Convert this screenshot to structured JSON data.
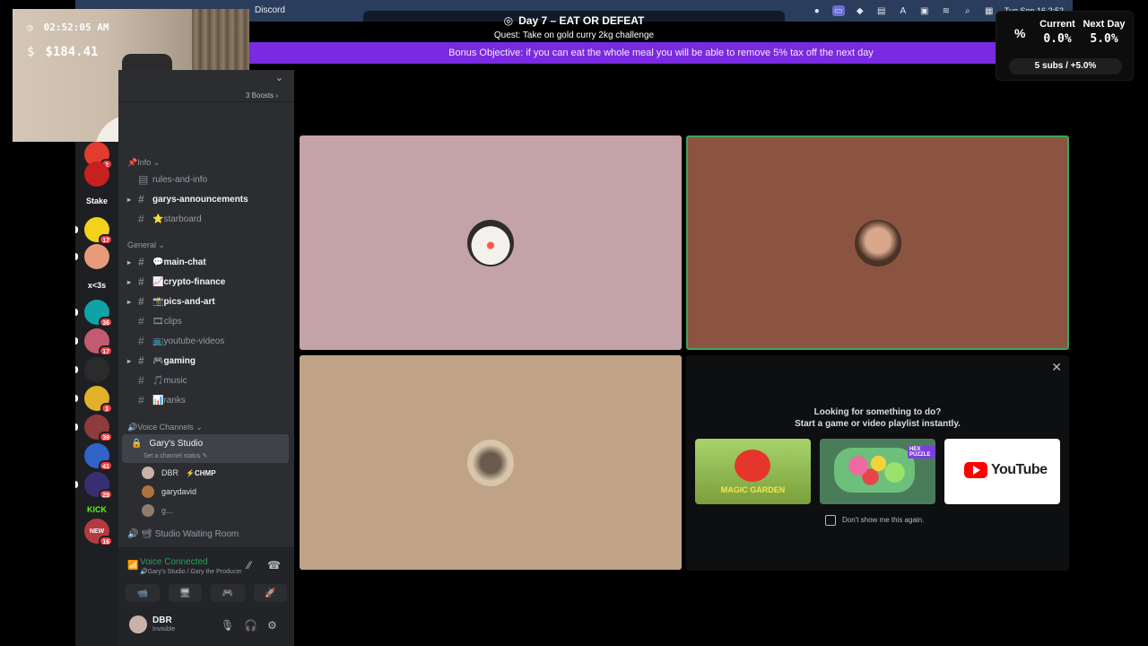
{
  "menubar": {
    "app_title": "Discord",
    "datetime": "Tue Sep 16  2:52"
  },
  "stream": {
    "title": "Day 7 – EAT OR DEFEAT",
    "title_icon": "◎",
    "quest": "Quest: Take on gold curry 2kg challenge",
    "bonus": "Bonus Objective: if you can eat the whole meal you will be able to remove 5% tax off the next day",
    "bonus_close": "✕"
  },
  "webcam": {
    "clock_icon": "◷",
    "time": "02:52:05 AM",
    "money_icon": "$",
    "money": "$184.41"
  },
  "stats": {
    "percent_icon": "%",
    "current_label": "Current",
    "current_value": "0.0%",
    "next_label": "Next Day",
    "next_value": "5.0%",
    "subs": "5 subs / +5.0%"
  },
  "servers": [
    {
      "label": "",
      "color": "#e23b2f",
      "badge": "2"
    },
    {
      "label": "",
      "color": "#c8201e",
      "badge": ""
    },
    {
      "label": "Stake",
      "color": "#1e1f22",
      "badge": ""
    },
    {
      "label": "",
      "color": "#f2d21b",
      "badge": "17"
    },
    {
      "label": "",
      "color": "#e99a7a",
      "badge": ""
    },
    {
      "label": "x<3s",
      "color": "#1e1f22",
      "badge": ""
    },
    {
      "label": "",
      "color": "#0fa3a8",
      "badge": "36"
    },
    {
      "label": "",
      "color": "#c25b6f",
      "badge": "17"
    },
    {
      "label": "",
      "color": "#2b2b2b",
      "badge": ""
    },
    {
      "label": "",
      "color": "#e3b02a",
      "badge": "3"
    },
    {
      "label": "",
      "color": "#8d3b3b",
      "badge": "39"
    },
    {
      "label": "",
      "color": "#2f63c7",
      "badge": "41"
    },
    {
      "label": "",
      "color": "#3a2e73",
      "badge": "29"
    },
    {
      "label": "KICK",
      "color": "#1e1f22",
      "badge": ""
    },
    {
      "label": "NEW",
      "color": "#b33b40",
      "badge": "16"
    }
  ],
  "sidebar": {
    "chevron": "⌄",
    "boosts": "3 Boosts ›",
    "categories": {
      "info": "📌Info ⌄",
      "general": "General ⌄",
      "voice": "🔊Voice Channels ⌄"
    },
    "channels": [
      {
        "name": "rules-and-info",
        "arrow": ""
      },
      {
        "name": "garys-announcements",
        "arrow": "▸"
      },
      {
        "name": "⭐starboard",
        "arrow": ""
      },
      {
        "name": "💬main-chat",
        "arrow": "▸"
      },
      {
        "name": "📈crypto-finance",
        "arrow": "▸"
      },
      {
        "name": "📸pics-and-art",
        "arrow": "▸"
      },
      {
        "name": "🎞clips",
        "arrow": ""
      },
      {
        "name": "📺youtube-videos",
        "arrow": ""
      },
      {
        "name": "🎮gaming",
        "arrow": "▸"
      },
      {
        "name": "🎵music",
        "arrow": ""
      },
      {
        "name": "📊ranks",
        "arrow": ""
      }
    ],
    "voice_channel": {
      "name": "Gary's Studio",
      "status": "Set a channel status ✎",
      "users": [
        {
          "name": "DBR",
          "tag": "⚡CHMP",
          "color": "#c9b2a8"
        },
        {
          "name": "garydavid",
          "tag": "",
          "color": "#b0713f"
        },
        {
          "name": "g...",
          "tag": "",
          "color": "#8d7d6a"
        }
      ]
    },
    "waiting_room": "🔊 📽 Studio Waiting Room"
  },
  "voice_panel": {
    "title": "Voice Connected",
    "subtitle": "🔊Gary's Studio / Gary the Producer",
    "signal_icon": "📶",
    "noise_icon": "⁄⁄",
    "disconnect_icon": "☎"
  },
  "actions": [
    "📹",
    "🖥",
    "🎮",
    "🚀"
  ],
  "user": {
    "name": "DBR",
    "status": "Invisible",
    "mic": "🎙",
    "headset": "🎧",
    "settings": "⚙"
  },
  "tiles": {
    "t1_bg": "#c4a3a8",
    "t2_bg": "#8a5440",
    "t3_bg": "#c0a287",
    "t2_border": "#3ba55d"
  },
  "activity": {
    "close": "✕",
    "line1": "Looking for something to do?",
    "line2": "Start a game or video playlist instantly.",
    "cards": [
      {
        "name": "MAGIC GARDEN",
        "bg": "#9bc25a"
      },
      {
        "name": "HEX PUZZLE",
        "bg": "#4b7c5a"
      },
      {
        "name": "YouTube",
        "bg": "#ffffff"
      }
    ],
    "checkbox_label": "Don't show me this again."
  }
}
